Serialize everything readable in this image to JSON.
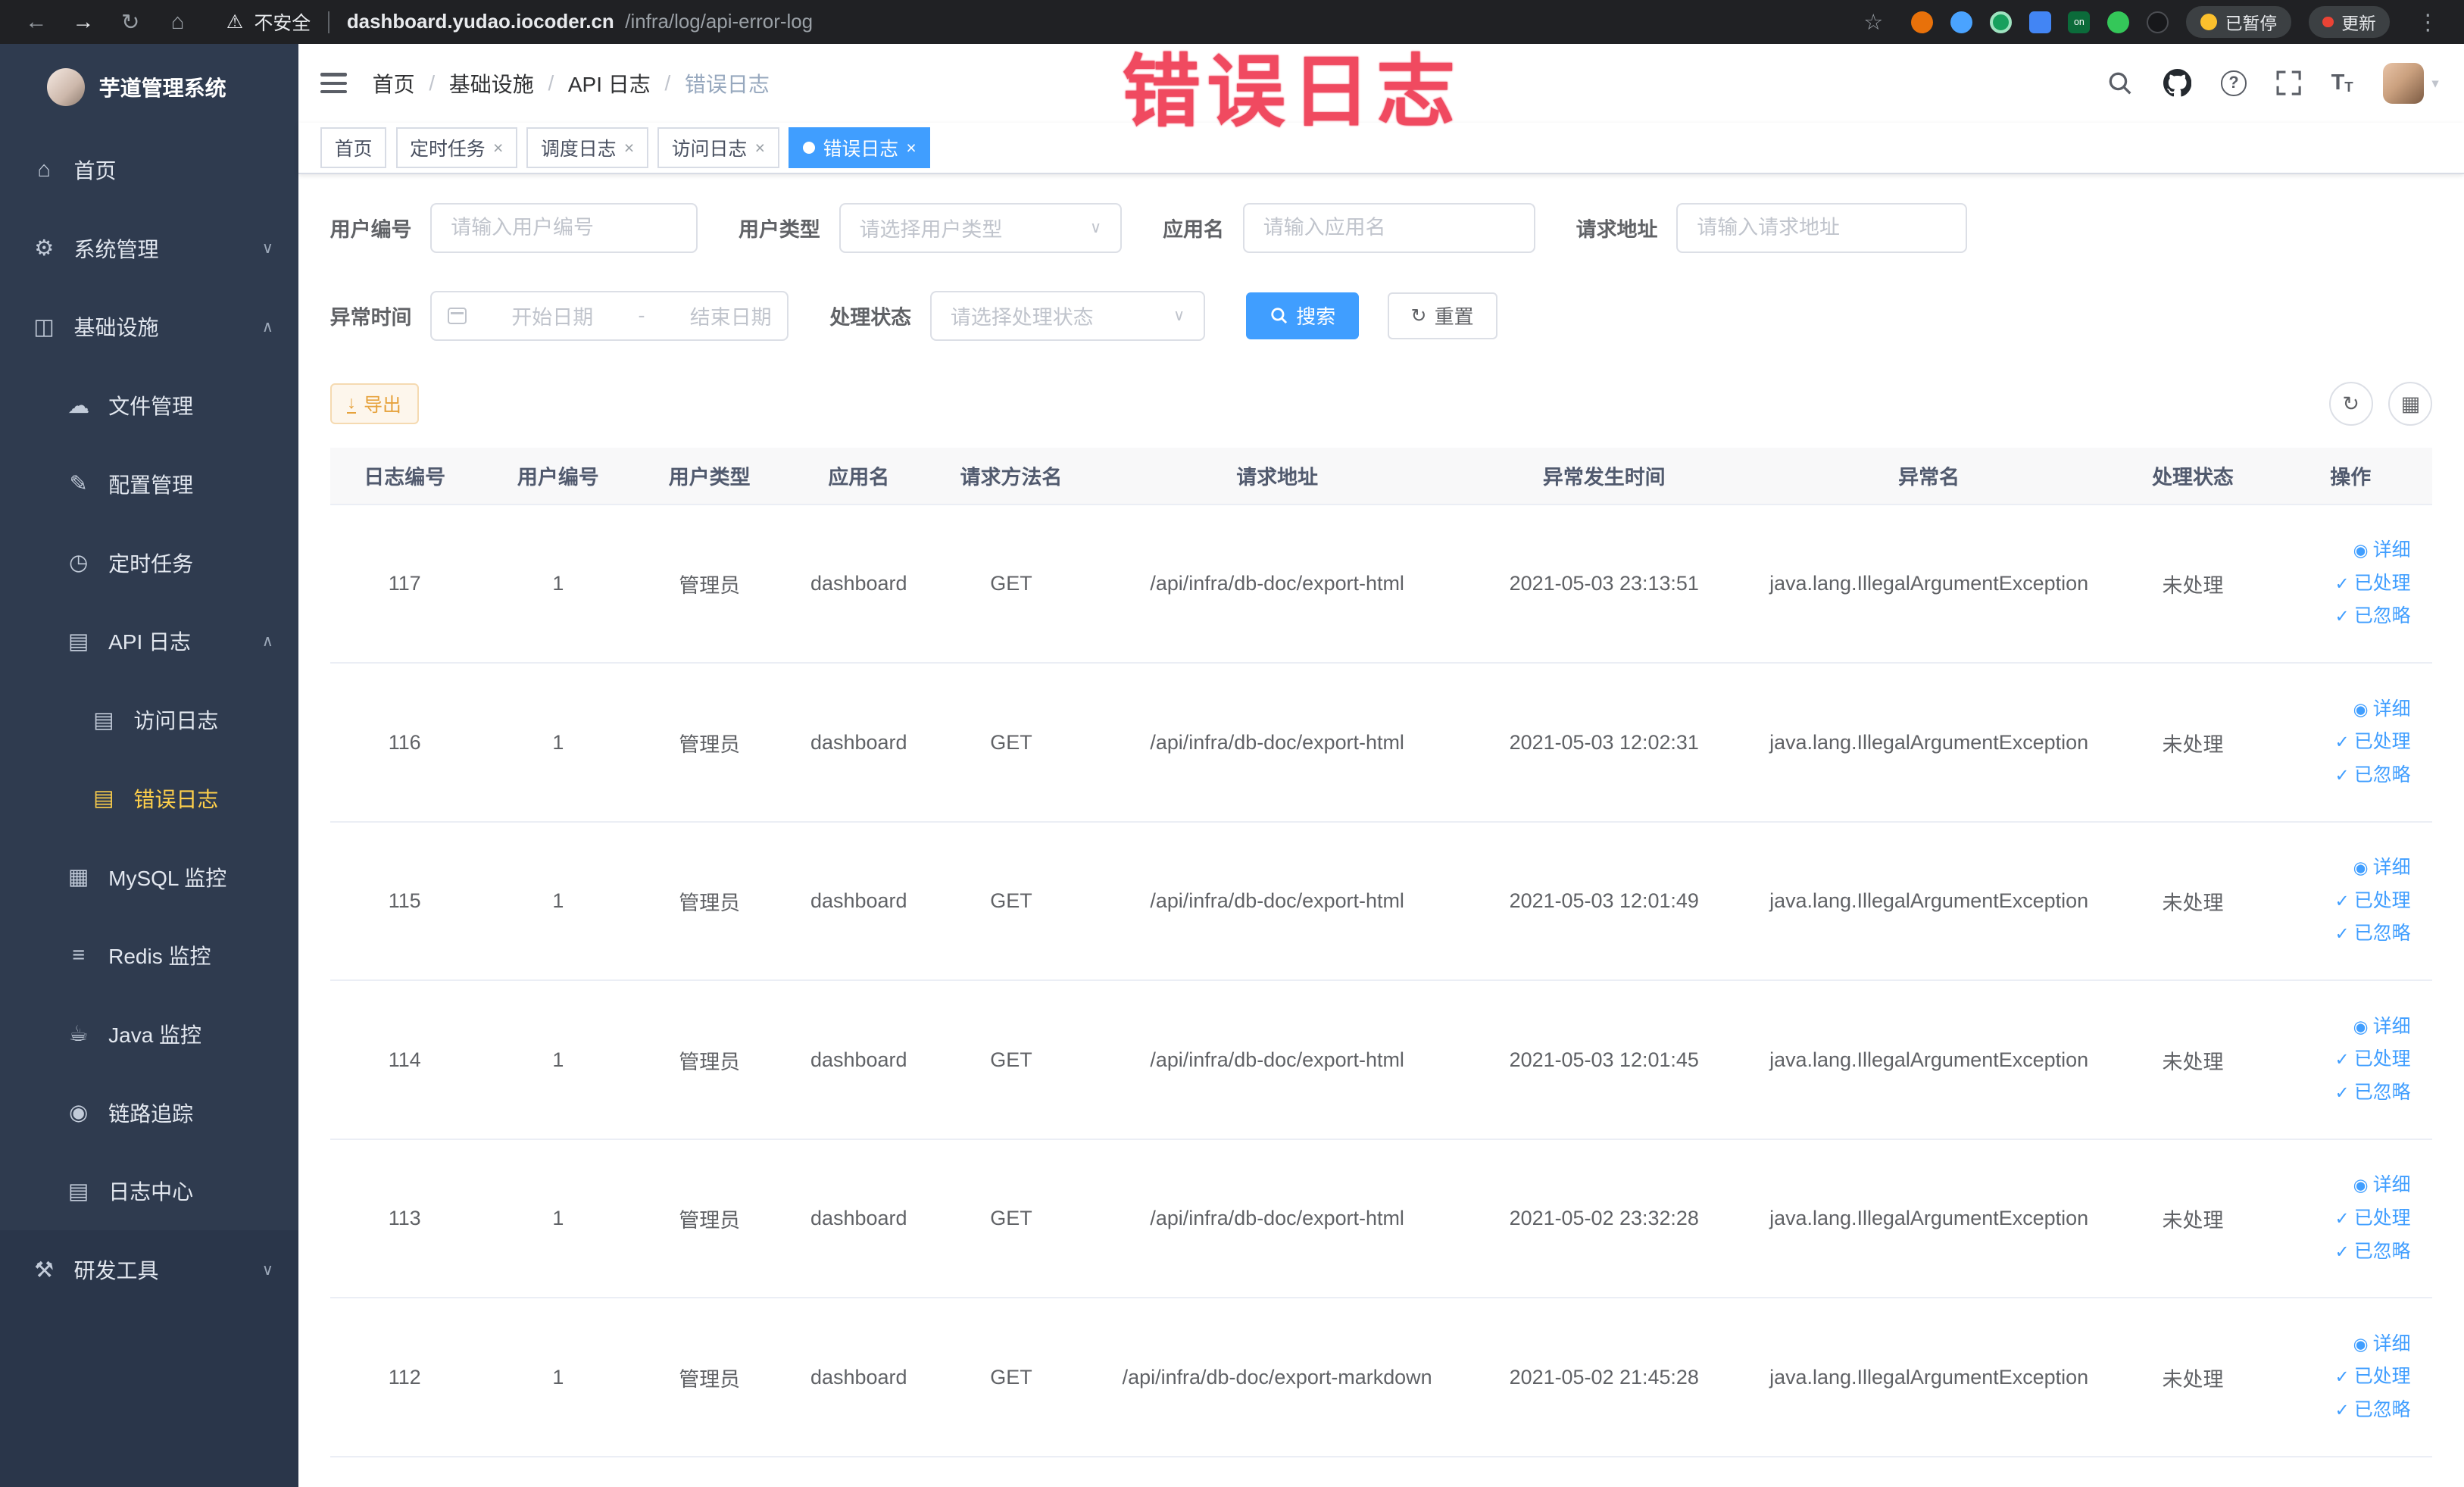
{
  "colors": {
    "primary": "#409eff",
    "active_menu": "#ffd04b",
    "warning": "#e6a23c",
    "watermark": "#f04a60"
  },
  "watermark": "错误日志",
  "browser": {
    "security": "不安全",
    "url_domain": "dashboard.yudao.iocoder.cn",
    "url_path": "/infra/log/api-error-log",
    "paused_label": "已暂停",
    "update_label": "更新"
  },
  "icons": {
    "back": "←",
    "forward": "→",
    "reload": "↻",
    "chrome_home": "⌂",
    "warning": "⚠",
    "star": "☆",
    "kebab": "⋮",
    "menu_home": "⌂",
    "menu_system": "⚙",
    "menu_infra": "◫",
    "menu_file": "☁",
    "menu_config": "✎",
    "menu_job": "◷",
    "menu_apilog": "▤",
    "menu_accesslog": "▤",
    "menu_errorlog": "▤",
    "menu_mysql": "▦",
    "menu_redis": "≡",
    "menu_java": "☕",
    "menu_trace": "◉",
    "menu_logcenter": "▤",
    "menu_devtools": "⚒",
    "chevron_down": "∨",
    "chevron_up": "∧",
    "caret_down": "▾",
    "select_caret": "∨",
    "question": "?",
    "font_big": "T",
    "font_small": "T",
    "close": "×",
    "active_dot": "",
    "download": "↓",
    "refresh": "↻",
    "grid": "▦",
    "eye": "◉",
    "check": "✓",
    "slash": "/"
  },
  "sidebar": {
    "title": "芋道管理系统",
    "menu": {
      "home": "首页",
      "system": "系统管理",
      "infra": "基础设施",
      "file": "文件管理",
      "config": "配置管理",
      "job": "定时任务",
      "apilog": "API 日志",
      "accesslog": "访问日志",
      "errorlog": "错误日志",
      "mysql": "MySQL 监控",
      "redis": "Redis 监控",
      "java": "Java 监控",
      "trace": "链路追踪",
      "logcenter": "日志中心",
      "devtools": "研发工具"
    }
  },
  "header": {
    "breadcrumb": [
      "首页",
      "基础设施",
      "API 日志",
      "错误日志"
    ]
  },
  "tabs": [
    {
      "label": "首页"
    },
    {
      "label": "定时任务"
    },
    {
      "label": "调度日志"
    },
    {
      "label": "访问日志"
    },
    {
      "label": "错误日志"
    }
  ],
  "filters": {
    "user_id_label": "用户编号",
    "user_id_placeholder": "请输入用户编号",
    "user_type_label": "用户类型",
    "user_type_placeholder": "请选择用户类型",
    "app_name_label": "应用名",
    "app_name_placeholder": "请输入应用名",
    "request_url_label": "请求地址",
    "request_url_placeholder": "请输入请求地址",
    "exception_time_label": "异常时间",
    "date_start_placeholder": "开始日期",
    "date_separator": "-",
    "date_end_placeholder": "结束日期",
    "process_status_label": "处理状态",
    "process_status_placeholder": "请选择处理状态",
    "search_button": "搜索",
    "reset_button": "重置"
  },
  "toolbar": {
    "export_button": "导出"
  },
  "table": {
    "columns": [
      "日志编号",
      "用户编号",
      "用户类型",
      "应用名",
      "请求方法名",
      "请求地址",
      "异常发生时间",
      "异常名",
      "处理状态",
      "操作"
    ],
    "actions": {
      "detail": "详细",
      "processed": "已处理",
      "ignored": "已忽略"
    },
    "rows": [
      {
        "id": "117",
        "user_id": "1",
        "user_type": "管理员",
        "app": "dashboard",
        "method": "GET",
        "url": "/api/infra/db-doc/export-html",
        "time": "2021-05-03 23:13:51",
        "exception": "java.lang.IllegalArgumentException",
        "status": "未处理"
      },
      {
        "id": "116",
        "user_id": "1",
        "user_type": "管理员",
        "app": "dashboard",
        "method": "GET",
        "url": "/api/infra/db-doc/export-html",
        "time": "2021-05-03 12:02:31",
        "exception": "java.lang.IllegalArgumentException",
        "status": "未处理"
      },
      {
        "id": "115",
        "user_id": "1",
        "user_type": "管理员",
        "app": "dashboard",
        "method": "GET",
        "url": "/api/infra/db-doc/export-html",
        "time": "2021-05-03 12:01:49",
        "exception": "java.lang.IllegalArgumentException",
        "status": "未处理"
      },
      {
        "id": "114",
        "user_id": "1",
        "user_type": "管理员",
        "app": "dashboard",
        "method": "GET",
        "url": "/api/infra/db-doc/export-html",
        "time": "2021-05-03 12:01:45",
        "exception": "java.lang.IllegalArgumentException",
        "status": "未处理"
      },
      {
        "id": "113",
        "user_id": "1",
        "user_type": "管理员",
        "app": "dashboard",
        "method": "GET",
        "url": "/api/infra/db-doc/export-html",
        "time": "2021-05-02 23:32:28",
        "exception": "java.lang.IllegalArgumentException",
        "status": "未处理"
      },
      {
        "id": "112",
        "user_id": "1",
        "user_type": "管理员",
        "app": "dashboard",
        "method": "GET",
        "url": "/api/infra/db-doc/export-markdown",
        "time": "2021-05-02 21:45:28",
        "exception": "java.lang.IllegalArgumentException",
        "status": "未处理"
      }
    ]
  }
}
